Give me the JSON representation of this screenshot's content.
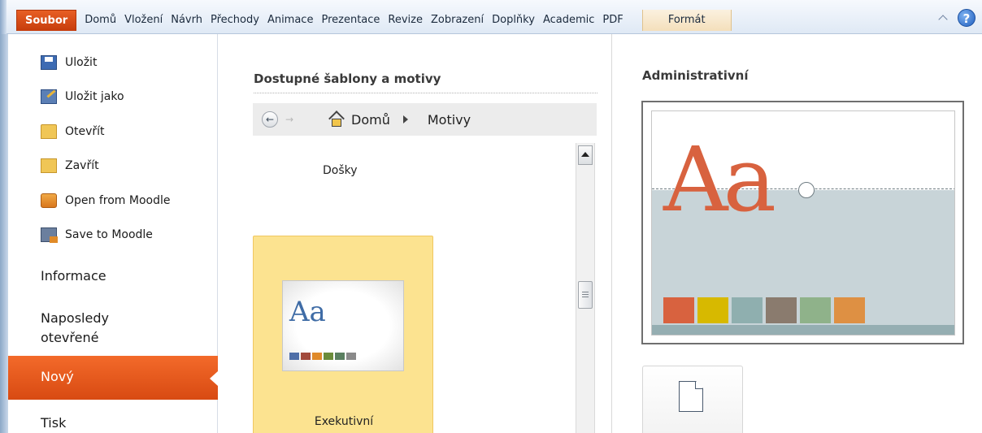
{
  "ribbon": {
    "file_tab": "Soubor",
    "tabs": [
      "Domů",
      "Vložení",
      "Návrh",
      "Přechody",
      "Animace",
      "Prezentace",
      "Revize",
      "Zobrazení",
      "Doplňky",
      "Academic",
      "PDF"
    ],
    "format_tab": "Formát",
    "help_label": "?"
  },
  "leftnav": {
    "commands": [
      {
        "label": "Uložit",
        "icon": "save-icon"
      },
      {
        "label": "Uložit jako",
        "icon": "save-as-icon"
      },
      {
        "label": "Otevřít",
        "icon": "open-folder-icon"
      },
      {
        "label": "Zavřít",
        "icon": "close-folder-icon"
      },
      {
        "label": "Open from Moodle",
        "icon": "moodle-open-icon"
      },
      {
        "label": "Save to Moodle",
        "icon": "moodle-save-icon"
      }
    ],
    "sections": {
      "info": "Informace",
      "recent_line1": "Naposledy",
      "recent_line2": "otevřené",
      "new": "Nový",
      "print": "Tisk"
    }
  },
  "middle": {
    "title": "Dostupné šablony a motivy",
    "back_glyph": "←",
    "forward_glyph": "→",
    "breadcrumb": [
      "Domů",
      "Motivy"
    ],
    "items": [
      {
        "label": "Došky"
      },
      {
        "label": "Exekutivní",
        "thumb_text": "Aa",
        "swatches": [
          "#4f6fa8",
          "#a24a3c",
          "#e08a2b",
          "#6b8c3a",
          "#5a7f60",
          "#8a8a8a"
        ]
      }
    ]
  },
  "right": {
    "title": "Administrativní",
    "preview_text": "Aa",
    "preview_colors": [
      "#d8623f",
      "#d7b900",
      "#8fafaf",
      "#8a7b6e",
      "#8fb28a",
      "#de9043"
    ]
  }
}
